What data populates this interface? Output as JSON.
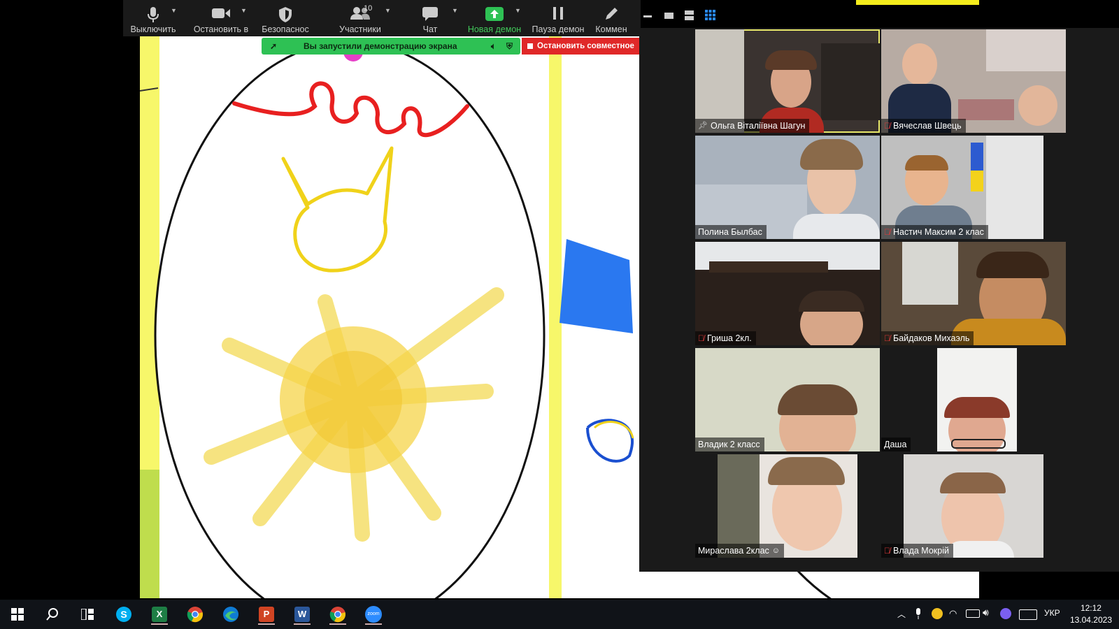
{
  "toolbar": {
    "mute_label": "Выключить",
    "video_label": "Остановить в",
    "security_label": "Безопаснос",
    "participants_label": "Участники",
    "participants_count": "10",
    "chat_label": "Чат",
    "new_share_label": "Новая демон",
    "pause_share_label": "Пауза демон",
    "annotate_label": "Коммен"
  },
  "share_banner": {
    "text": "Вы запустили демонстрацию экрана",
    "stop_text": "Остановить совместное"
  },
  "gallery": {
    "tiles": [
      {
        "name": "Ольга Віталіївна Шагун",
        "muted": false,
        "pinned": true,
        "active": true
      },
      {
        "name": "Вячеслав Швець",
        "muted": true,
        "pinned": false,
        "active": false
      },
      {
        "name": "Полина Былбас",
        "muted": false,
        "pinned": false,
        "active": false
      },
      {
        "name": "Настич Максим 2 клас",
        "muted": true,
        "pinned": false,
        "active": false
      },
      {
        "name": "Гриша 2кл.",
        "muted": true,
        "pinned": false,
        "active": false
      },
      {
        "name": "Байдаков Михаэль",
        "muted": true,
        "pinned": false,
        "active": false
      },
      {
        "name": "Владик 2 класс",
        "muted": false,
        "pinned": false,
        "active": false
      },
      {
        "name": "Даша",
        "muted": false,
        "pinned": false,
        "active": false
      },
      {
        "name": "Мирaслава 2клас",
        "muted": false,
        "pinned": false,
        "active": false
      },
      {
        "name": "Влада Мокрій",
        "muted": true,
        "pinned": false,
        "active": false
      }
    ]
  },
  "taskbar": {
    "apps": [
      "windows-start",
      "search",
      "task-view",
      "skype",
      "excel",
      "chrome",
      "edge",
      "powerpoint",
      "word",
      "chrome-profile",
      "zoom"
    ],
    "language": "УКР",
    "time": "12:12",
    "date": "13.04.2023"
  },
  "colors": {
    "zoom_green": "#2ec154",
    "stop_red": "#e02828",
    "active_speaker": "#e8e86a",
    "toolbar_bg": "#1a1a1a"
  }
}
